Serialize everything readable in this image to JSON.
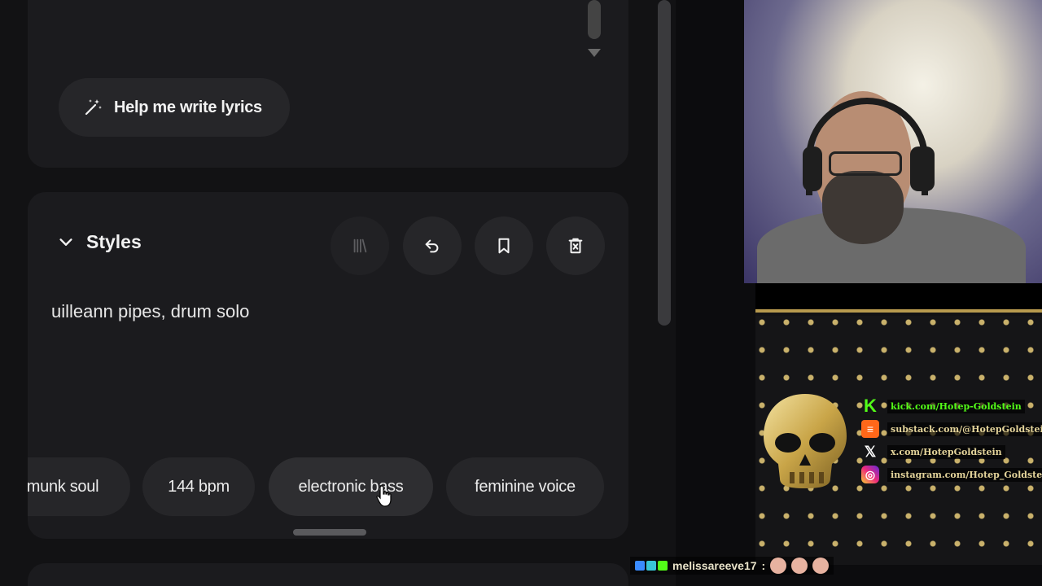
{
  "lyrics": {
    "help_button": "Help me write lyrics"
  },
  "styles": {
    "title": "Styles",
    "text": "uilleann pipes, drum solo",
    "chips": [
      "munk soul",
      "144 bpm",
      "electronic bass",
      "feminine voice"
    ]
  },
  "colors": {
    "panel": "#1b1b1e",
    "chip": "#262629",
    "text": "#ececec",
    "accent_gold": "#c9b16b",
    "kick_green": "#53fc18"
  },
  "icons": {
    "help": "magic-wand-icon",
    "collapse": "chevron-down-icon",
    "library": "library-icon",
    "undo": "undo-icon",
    "bookmark": "bookmark-icon",
    "delete": "delete-icon"
  },
  "overlay": {
    "socials": [
      {
        "icon": "kick-icon",
        "label": "kick.com/Hotep-Goldstein"
      },
      {
        "icon": "substack-icon",
        "label": "substack.com/@HotepGoldstein"
      },
      {
        "icon": "x-icon",
        "label": "x.com/HotepGoldstein"
      },
      {
        "icon": "instagram-icon",
        "label": "instagram.com/Hotep_Goldstein"
      }
    ],
    "chat": {
      "username": "melissareeve17",
      "separator": ":"
    }
  }
}
